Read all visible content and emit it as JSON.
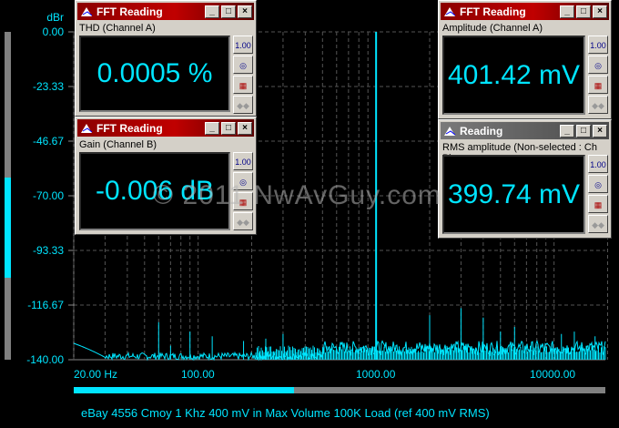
{
  "y_axis": {
    "unit": "dBr",
    "ticks": [
      "0.00",
      "-23.33",
      "-46.67",
      "-70.00",
      "-93.33",
      "-116.67",
      "-140.00"
    ]
  },
  "x_axis": {
    "ticks": [
      "20.00 Hz",
      "100.00",
      "1000.00",
      "10000.00"
    ]
  },
  "caption": "eBay 4556 Cmoy 1 Khz 400 mV in Max Volume 100K Load (ref 400 mV RMS)",
  "watermark": "© 2011 NwAvGuy.com",
  "colors": {
    "trace": "#00e5ff",
    "title_active": "#c00000",
    "title_inactive": "#6a6a6a"
  },
  "level_bar": {
    "fill_top_dBr": -70,
    "fill_bottom_dBr": -110
  },
  "scrollbar": {
    "visible_fraction": 0.41
  },
  "chart_data": {
    "type": "line",
    "xscale": "log",
    "xlim": [
      20,
      20000
    ],
    "ylim": [
      -140,
      0
    ],
    "ylabel": "dBr",
    "noise_floor_dBr": -136,
    "peaks": [
      [
        60,
        -124
      ],
      [
        70,
        -134
      ],
      [
        90,
        -128
      ],
      [
        120,
        -130
      ],
      [
        180,
        -132
      ],
      [
        240,
        -131
      ],
      [
        300,
        -129
      ],
      [
        1000,
        0
      ],
      [
        2000,
        -121
      ],
      [
        3000,
        -118
      ],
      [
        4000,
        -122
      ],
      [
        5000,
        -128
      ],
      [
        6000,
        -126
      ],
      [
        11000,
        -129
      ],
      [
        13000,
        -128
      ],
      [
        17000,
        -130
      ]
    ]
  },
  "windows": [
    {
      "title": "FFT Reading",
      "label": "THD (Channel A)",
      "value": "0.0005 %"
    },
    {
      "title": "FFT Reading",
      "label": "Gain (Channel B)",
      "value": "-0.006 dB"
    },
    {
      "title": "FFT Reading",
      "label": "Amplitude (Channel A)",
      "value": "401.42 mV"
    },
    {
      "title": "Reading",
      "label": "RMS amplitude (Non-selected : Ch B)",
      "value": "399.74 mV"
    }
  ],
  "side_buttons": {
    "precision": "1.00"
  }
}
